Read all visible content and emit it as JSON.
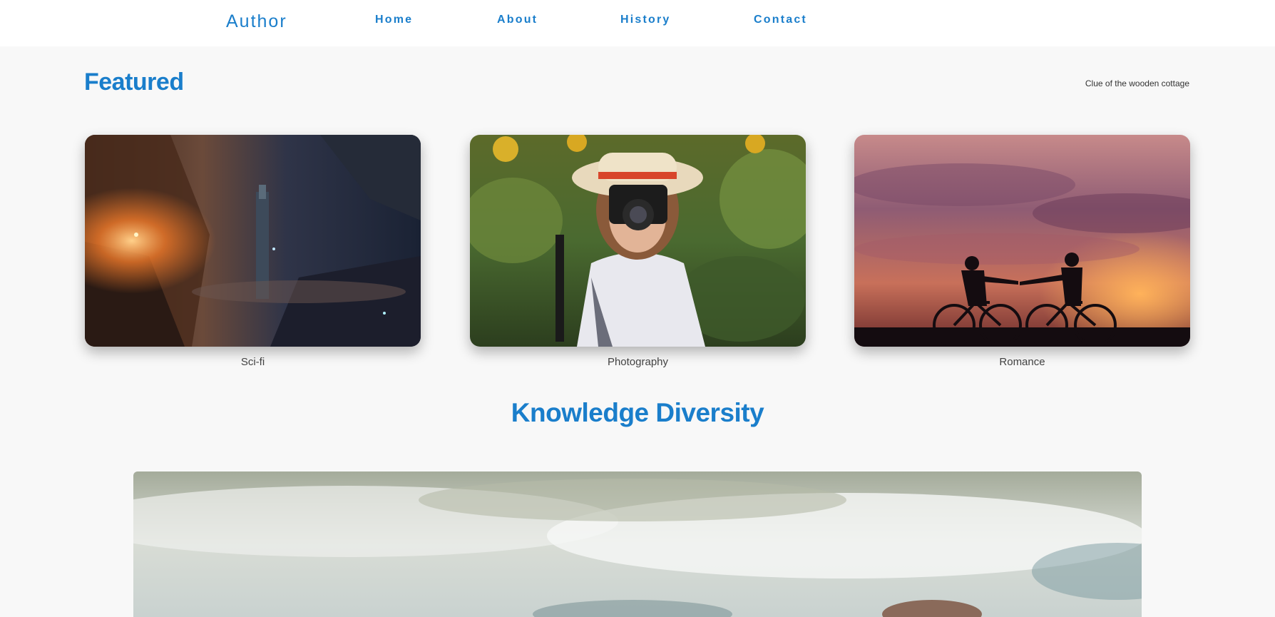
{
  "nav": {
    "brand": "Author",
    "links": [
      {
        "label": "Home"
      },
      {
        "label": "About"
      },
      {
        "label": "History"
      },
      {
        "label": "Contact"
      }
    ]
  },
  "featured": {
    "title": "Featured",
    "subtitle": "Clue of the wooden cottage",
    "cards": [
      {
        "label": "Sci-fi",
        "image": "sci-fi-city-image"
      },
      {
        "label": "Photography",
        "image": "woman-with-camera-image"
      },
      {
        "label": "Romance",
        "image": "couple-on-bicycles-sunset-image"
      }
    ]
  },
  "knowledge": {
    "title": "Knowledge Diversity",
    "image": "cloudy-sky-hero-image"
  },
  "colors": {
    "accent": "#1a7ecb",
    "background": "#f8f8f8",
    "navbar": "#ffffff"
  }
}
